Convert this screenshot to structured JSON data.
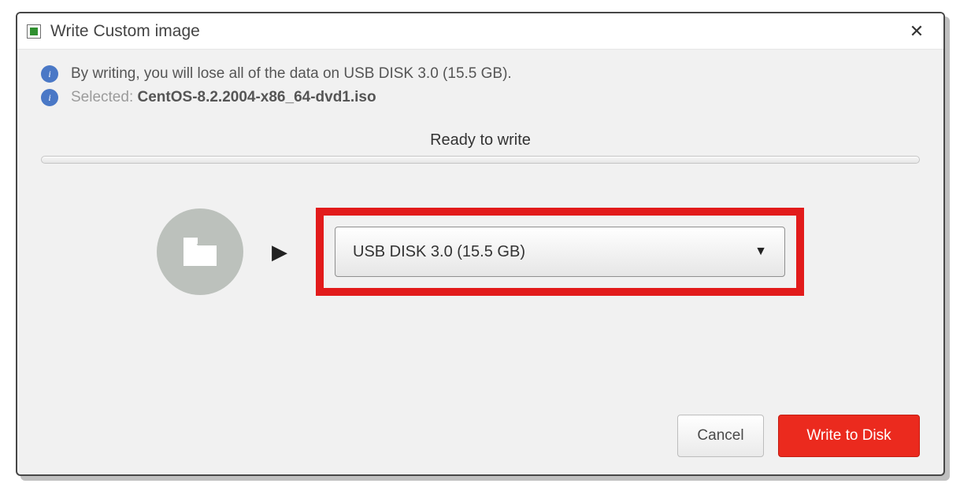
{
  "window": {
    "title": "Write Custom image"
  },
  "info": {
    "warning": "By writing, you will lose all of the data on USB DISK 3.0 (15.5 GB).",
    "selected_label": "Selected:",
    "selected_file": "CentOS-8.2.2004-x86_64-dvd1.iso"
  },
  "status": {
    "label": "Ready to write"
  },
  "target": {
    "dropdown_value": "USB DISK 3.0 (15.5 GB)"
  },
  "buttons": {
    "cancel": "Cancel",
    "write": "Write to Disk"
  },
  "icons": {
    "info_glyph": "i",
    "arrow_glyph": "▶",
    "caret_glyph": "▼",
    "close_glyph": "✕"
  },
  "colors": {
    "highlight": "#e21b1b",
    "primary_button": "#eb2a1e",
    "info_badge": "#4a78c6"
  }
}
